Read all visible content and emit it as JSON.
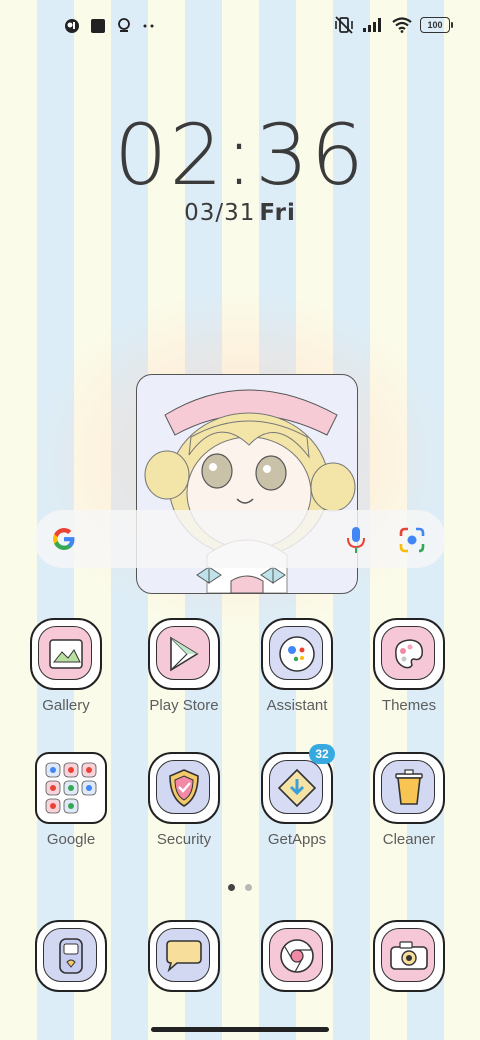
{
  "status_bar": {
    "battery": "100",
    "icons": [
      "notification-icon",
      "square-app-icon",
      "assistant-icon",
      "more-dots-icon",
      "vibrate-off-icon",
      "signal-icon",
      "wifi-icon",
      "battery-icon"
    ]
  },
  "lockclock": {
    "time": "02:36",
    "date": "03/31",
    "day": "Fri"
  },
  "search_bar": {
    "icons": [
      "google-logo-icon",
      "microphone-icon",
      "lens-camera-icon"
    ]
  },
  "apps": [
    {
      "label": "Gallery",
      "icon": "gallery-icon",
      "bg": "#f7c8d6"
    },
    {
      "label": "Play Store",
      "icon": "play-store-icon",
      "bg": "#f5c9d8"
    },
    {
      "label": "Assistant",
      "icon": "assistant-icon",
      "bg": "#d7dcf4"
    },
    {
      "label": "Themes",
      "icon": "themes-icon",
      "bg": "#f6c7d6"
    },
    {
      "label": "Google",
      "icon": "google-folder-icon",
      "bg": "#ffffff"
    },
    {
      "label": "Security",
      "icon": "security-icon",
      "bg": "#d3d8f2"
    },
    {
      "label": "GetApps",
      "icon": "getapps-icon",
      "bg": "#d7dcf4",
      "badge": "32"
    },
    {
      "label": "Cleaner",
      "icon": "cleaner-icon",
      "bg": "#d3d8f2"
    }
  ],
  "dock": [
    {
      "icon": "phone-icon",
      "bg": "#d3d8f2"
    },
    {
      "icon": "messages-icon",
      "bg": "#d3d8f2"
    },
    {
      "icon": "chrome-icon",
      "bg": "#f6c7d6"
    },
    {
      "icon": "camera-icon",
      "bg": "#f6c7d6"
    }
  ],
  "page_indicator": {
    "pages": 2,
    "current": 1
  },
  "colors": {
    "stripe_cream": "#fbfbe9",
    "stripe_blue": "#dcedf7",
    "badge": "#36a9e1",
    "text": "#5d5d5d"
  }
}
